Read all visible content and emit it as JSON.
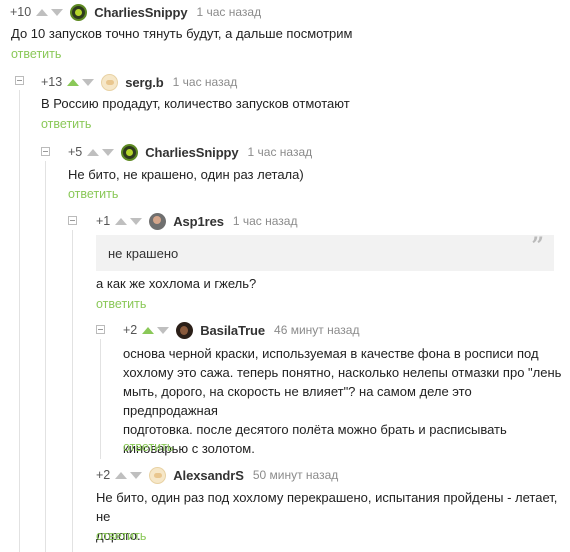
{
  "comments": [
    {
      "rating": "+10",
      "user": "CharliesSnippy",
      "time": "1 час назад",
      "text": "До 10 запусков точно тянуть будут, а дальше посмотрим",
      "reply": "ответить"
    },
    {
      "rating": "+13",
      "user": "serg.b",
      "time": "1 час назад",
      "text": "В Россию продадут, количество запусков отмотают",
      "reply": "ответить"
    },
    {
      "rating": "+5",
      "user": "CharliesSnippy",
      "time": "1 час назад",
      "text": "Не бито, не крашено, один раз летала)",
      "reply": "ответить"
    },
    {
      "rating": "+1",
      "user": "Asp1res",
      "time": "1 час назад",
      "quote": "не крашено",
      "text": "а как же хохлома и гжель?",
      "reply": "ответить"
    },
    {
      "rating": "+2",
      "user": "BasilaTrue",
      "time": "46 минут назад",
      "text_lines": [
        "основа черной краски, используемая в качестве фона в росписи под",
        "хохлому это сажа. теперь понятно, насколько нелепы отмазки про \"лень",
        "мыть, дорого, на скорость не влияет\"? на самом деле это предпродажная",
        "подготовка. после десятого полёта можно брать и расписывать",
        "киноварью с золотом."
      ],
      "reply": "ответить"
    },
    {
      "rating": "+2",
      "user": "AlexsandrS",
      "time": "50 минут назад",
      "text_lines": [
        "Не бито, один раз под хохлому перекрашено, испытания пройдены - летает, не",
        "дорого."
      ],
      "reply": "ответить"
    }
  ],
  "colors": {
    "accent": "#8ac858",
    "muted": "#8b8b8b",
    "quote_bg": "#f2f2f2"
  },
  "icons": {
    "vote_up": "triangle-up-icon",
    "vote_down": "triangle-down-icon",
    "collapse": "collapse-minus-icon",
    "quote": "quote-icon"
  }
}
